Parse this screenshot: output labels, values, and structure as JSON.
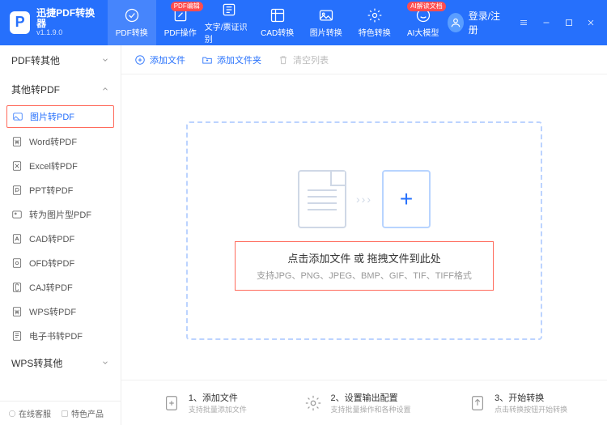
{
  "app": {
    "title": "迅捷PDF转换器",
    "version": "v1.1.9.0"
  },
  "header_tabs": [
    {
      "label": "PDF转换",
      "badge": null
    },
    {
      "label": "PDF操作",
      "badge": "PDF编辑"
    },
    {
      "label": "文字/票证识别",
      "badge": null
    },
    {
      "label": "CAD转换",
      "badge": null
    },
    {
      "label": "图片转换",
      "badge": null
    },
    {
      "label": "特色转换",
      "badge": null
    },
    {
      "label": "AI大模型",
      "badge": "AI解读文档"
    }
  ],
  "login_label": "登录/注册",
  "sidebar": {
    "cats": [
      {
        "label": "PDF转其他",
        "expanded": false
      },
      {
        "label": "其他转PDF",
        "expanded": true
      },
      {
        "label": "WPS转其他",
        "expanded": false
      }
    ],
    "items": [
      {
        "label": "图片转PDF",
        "active": true
      },
      {
        "label": "Word转PDF"
      },
      {
        "label": "Excel转PDF"
      },
      {
        "label": "PPT转PDF"
      },
      {
        "label": "转为图片型PDF"
      },
      {
        "label": "CAD转PDF"
      },
      {
        "label": "OFD转PDF"
      },
      {
        "label": "CAJ转PDF"
      },
      {
        "label": "WPS转PDF"
      },
      {
        "label": "电子书转PDF"
      }
    ],
    "footer": {
      "support": "在线客服",
      "featured": "特色产品"
    }
  },
  "toolbar": {
    "add_file": "添加文件",
    "add_folder": "添加文件夹",
    "clear_list": "清空列表"
  },
  "drop": {
    "title": "点击添加文件 或 拖拽文件到此处",
    "subtitle": "支持JPG、PNG、JPEG、BMP、GIF、TIF、TIFF格式"
  },
  "steps": [
    {
      "num": "1、",
      "title": "添加文件",
      "sub": "支持批量添加文件"
    },
    {
      "num": "2、",
      "title": "设置输出配置",
      "sub": "支持批量操作和各种设置"
    },
    {
      "num": "3、",
      "title": "开始转换",
      "sub": "点击转换按钮开始转换"
    }
  ]
}
